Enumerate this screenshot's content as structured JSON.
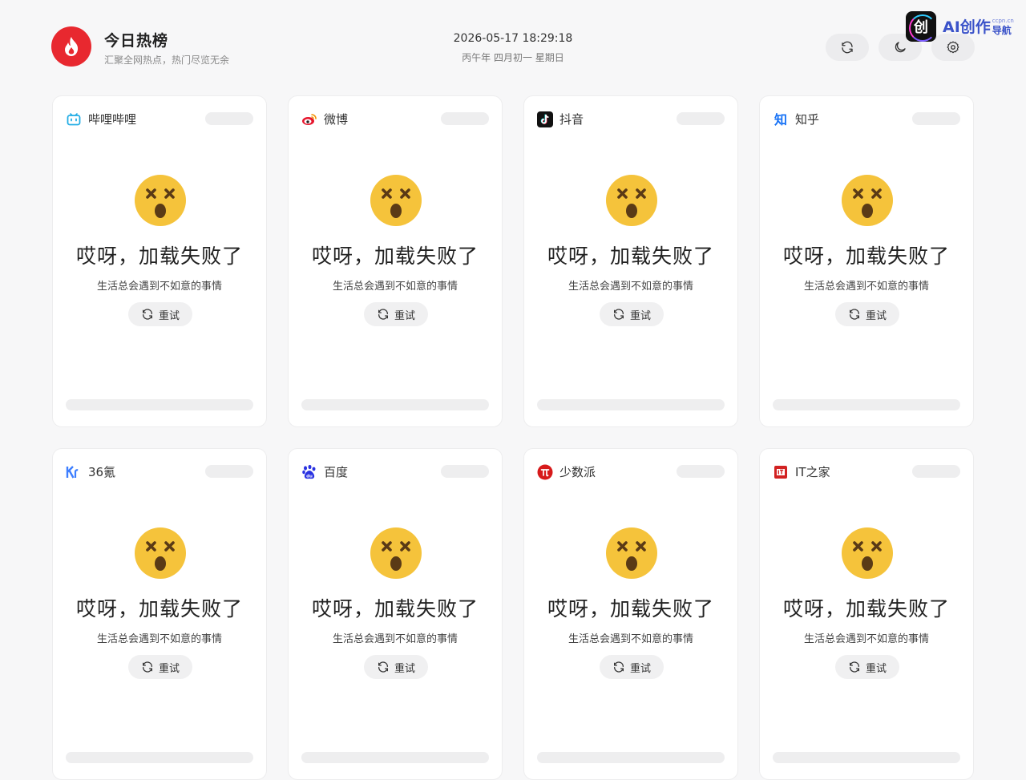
{
  "header": {
    "title": "今日热榜",
    "subtitle": "汇聚全网热点，热门尽览无余",
    "datetime": "2026-05-17 18:29:18",
    "lunar": "丙午年 四月初一 星期日",
    "buttons": [
      {
        "icon": "refresh-icon"
      },
      {
        "icon": "moon-icon"
      },
      {
        "icon": "settings-icon"
      }
    ],
    "badge": {
      "glyph": "创",
      "main": "AI创作",
      "small": "ccpn.cn",
      "nav": "导航"
    }
  },
  "error": {
    "title": "哎呀，加载失败了",
    "desc": "生活总会遇到不如意的事情",
    "retry": "重试"
  },
  "sources": [
    {
      "name": "哔哩哔哩",
      "icon": "bilibili-icon",
      "color": "#23ade5"
    },
    {
      "name": "微博",
      "icon": "weibo-icon",
      "color": "#e6162d"
    },
    {
      "name": "抖音",
      "icon": "douyin-icon",
      "color": "#111111"
    },
    {
      "name": "知乎",
      "icon": "zhihu-icon",
      "color": "#1772f6"
    },
    {
      "name": "36氪",
      "icon": "36kr-icon",
      "color": "#3d7eff"
    },
    {
      "name": "百度",
      "icon": "baidu-icon",
      "color": "#2932e1"
    },
    {
      "name": "少数派",
      "icon": "sspai-icon",
      "color": "#d71a1b"
    },
    {
      "name": "IT之家",
      "icon": "ithome-icon",
      "color": "#d22222"
    }
  ],
  "colors": {
    "brand": "#e8282f",
    "background": "#f7f7f8",
    "emoji": "#f5c33b"
  }
}
